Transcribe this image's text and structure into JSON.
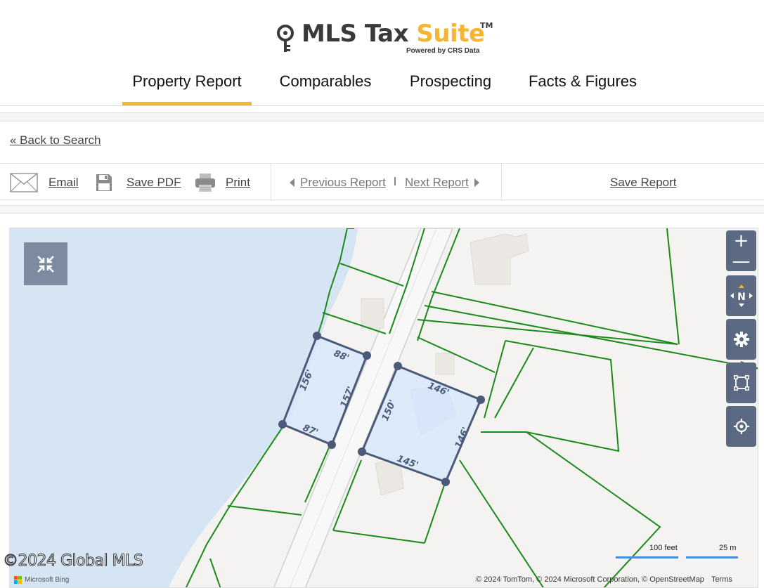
{
  "logo": {
    "word": "MLS Tax ",
    "word_accent": "Suite",
    "trademark": "TM",
    "tagline": "Powered by CRS Data",
    "accent_color": "#f5b532"
  },
  "nav": {
    "tabs": [
      {
        "label": "Property Report",
        "active": true
      },
      {
        "label": "Comparables",
        "active": false
      },
      {
        "label": "Prospecting",
        "active": false
      },
      {
        "label": "Facts & Figures",
        "active": false
      }
    ]
  },
  "back_link": "« Back to Search",
  "toolbar": {
    "email_label": "Email",
    "save_pdf_label": "Save PDF",
    "print_label": "Print",
    "prev_label": "Previous Report",
    "next_label": "Next Report",
    "save_report_label": "Save Report"
  },
  "map": {
    "icons": {
      "collapse": "collapse-arrows-icon",
      "zoom_in": "plus-icon",
      "zoom_out": "minus-icon",
      "compass": "compass-north-icon",
      "settings": "gear-icon",
      "select": "select-area-icon",
      "locate": "crosshair-icon"
    },
    "zoom_in": "+",
    "zoom_out": "—",
    "compass_label": "N",
    "parcel_left_dims": [
      "88'",
      "156'",
      "157'",
      "87'"
    ],
    "parcel_right_dims": [
      "146'",
      "150'",
      "146'",
      "145'"
    ],
    "scale_feet": "100 feet",
    "scale_meters": "25 m",
    "attribution": "© 2024 TomTom, © 2024 Microsoft Corporation, © OpenStreetMap",
    "terms": "Terms",
    "provider": "Microsoft Bing",
    "colors": {
      "water": "#d6e5f3",
      "parcel_line": "#1a8a1a",
      "parcel_fill": "#d8e8fa",
      "parcel_outline": "#4a5a78"
    }
  },
  "watermark": "©2024 Global MLS"
}
